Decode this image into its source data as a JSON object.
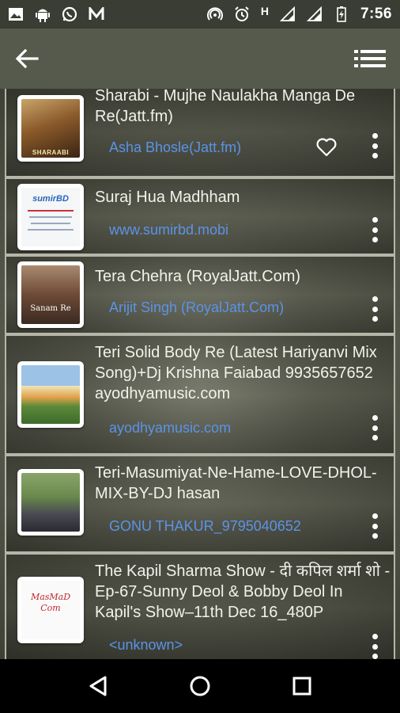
{
  "status_bar": {
    "time": "7:56",
    "network_label": "H",
    "left_icons": [
      "image-icon",
      "android-icon",
      "whatsapp-icon",
      "n-app-icon"
    ],
    "right_icons": [
      "hotspot-icon",
      "alarm-icon",
      "signal-icon",
      "signal-icon",
      "battery-charging-icon"
    ]
  },
  "app_bar": {
    "back_icon": "arrow-left-icon",
    "menu_icon": "list-menu-icon"
  },
  "songs": [
    {
      "title": "Sharabi - Mujhe Naulakha Manga De Re(Jatt.fm)",
      "artist": "Asha Bhosle(Jatt.fm)",
      "thumb_text": "SHARAABI",
      "favorite": true
    },
    {
      "title": "Suraj Hua Madhham",
      "artist": "www.sumirbd.mobi",
      "thumb_text": "sumirBD",
      "favorite": false
    },
    {
      "title": "Tera Chehra (RoyalJatt.Com)",
      "artist": "Arijit Singh (RoyalJatt.Com)",
      "thumb_text": "Sanam Re",
      "favorite": false
    },
    {
      "title": "Teri Solid Body Re (Latest Hariyanvi Mix Song)+Dj Krishna Faiabad 9935657652 ayodhyamusic.com",
      "artist": "ayodhyamusic.com",
      "thumb_text": "",
      "favorite": false
    },
    {
      "title": "Teri-Masumiyat-Ne-Hame-LOVE-DHOL-MIX-BY-DJ hasan",
      "artist": "GONU THAKUR_9795040652",
      "thumb_text": "",
      "favorite": false
    },
    {
      "title": "The Kapil Sharma Show - दी कपिल शर्मा शो - Ep-67-Sunny Deol & Bobby Deol In Kapil's Show–11th Dec 16_480P",
      "artist": "<unknown>",
      "thumb_text": "MasMaD Com",
      "favorite": false
    }
  ],
  "nav_bar": {
    "buttons": [
      "back-triangle-icon",
      "home-circle-icon",
      "recents-square-icon"
    ]
  },
  "colors": {
    "accent_text": "#5b93e6",
    "app_bar": "#555a4d",
    "status_bar": "#3a3d33"
  }
}
